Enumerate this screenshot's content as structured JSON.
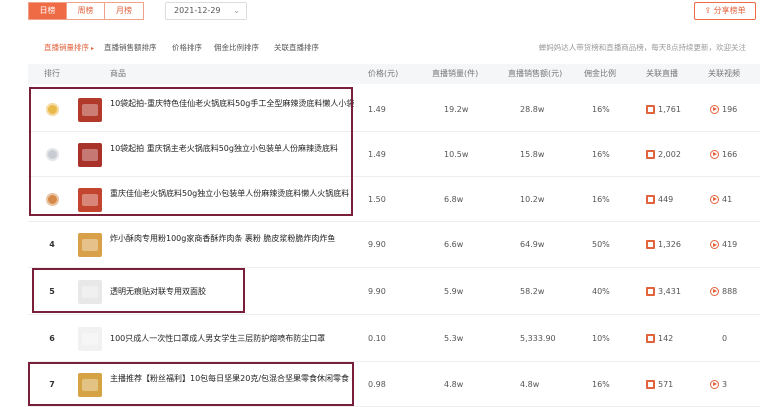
{
  "toolbar": {
    "tabs": [
      "日榜",
      "周榜",
      "月榜"
    ],
    "date": "2021-12-29",
    "share_label": "分享榜单"
  },
  "filters": {
    "tabs": [
      "直播销量排序",
      "直播销售额排序",
      "价格排序",
      "佣金比例排序",
      "关联直播排序"
    ],
    "note": "蝉妈妈达人带货榜和直播商品榜，每天8点持续更新，欢迎关注"
  },
  "columns": [
    "排行",
    "商品",
    "价格(元)",
    "直播销量(件)",
    "直播销售额(元)",
    "佣金比例",
    "关联直播",
    "关联视频"
  ],
  "rows": [
    {
      "rank": "1",
      "title": "10袋起拍-重庆特色佳仙老火锅底料50g手工全型麻辣烫底料懒人小袋",
      "price": "1.49",
      "sales": "19.2w",
      "revenue": "28.8w",
      "commission": "16%",
      "lives": "1,761",
      "videos": "196"
    },
    {
      "rank": "2",
      "title": "10袋起拍 重庆锅主老火锅底料50g独立小包装单人份麻辣烫底料",
      "price": "1.49",
      "sales": "10.5w",
      "revenue": "15.8w",
      "commission": "16%",
      "lives": "2,002",
      "videos": "166"
    },
    {
      "rank": "3",
      "title": "重庆佳仙老火锅底料50g独立小包装单人份麻辣烫底料懒人火锅底料",
      "price": "1.50",
      "sales": "6.8w",
      "revenue": "10.2w",
      "commission": "16%",
      "lives": "449",
      "videos": "41"
    },
    {
      "rank": "4",
      "title": "炸小酥肉专用粉100g家商香酥炸肉条 裹粉 脆皮浆粉脆炸肉炸鱼",
      "price": "9.90",
      "sales": "6.6w",
      "revenue": "64.9w",
      "commission": "50%",
      "lives": "1,326",
      "videos": "419"
    },
    {
      "rank": "5",
      "title": "透明无痕贴对联专用双面胶",
      "price": "9.90",
      "sales": "5.9w",
      "revenue": "58.2w",
      "commission": "40%",
      "lives": "3,431",
      "videos": "888"
    },
    {
      "rank": "6",
      "title": "100只成人一次性口罩成人男女学生三层防护熔喷布防尘口罩",
      "price": "0.10",
      "sales": "5.3w",
      "revenue": "5,333.90",
      "commission": "10%",
      "lives": "142",
      "videos": "0"
    },
    {
      "rank": "7",
      "title": "主播推荐【粉丝福利】10包每日坚果20克/包混合坚果零食休闲零食",
      "price": "0.98",
      "sales": "4.8w",
      "revenue": "4.8w",
      "commission": "16%",
      "lives": "571",
      "videos": "3"
    }
  ],
  "colors": {
    "accent": "#ef6b45",
    "highlight_box": "#7a1f3a",
    "gold": "#e9b949",
    "silver": "#c9ccd2",
    "bronze": "#d58a4a"
  }
}
